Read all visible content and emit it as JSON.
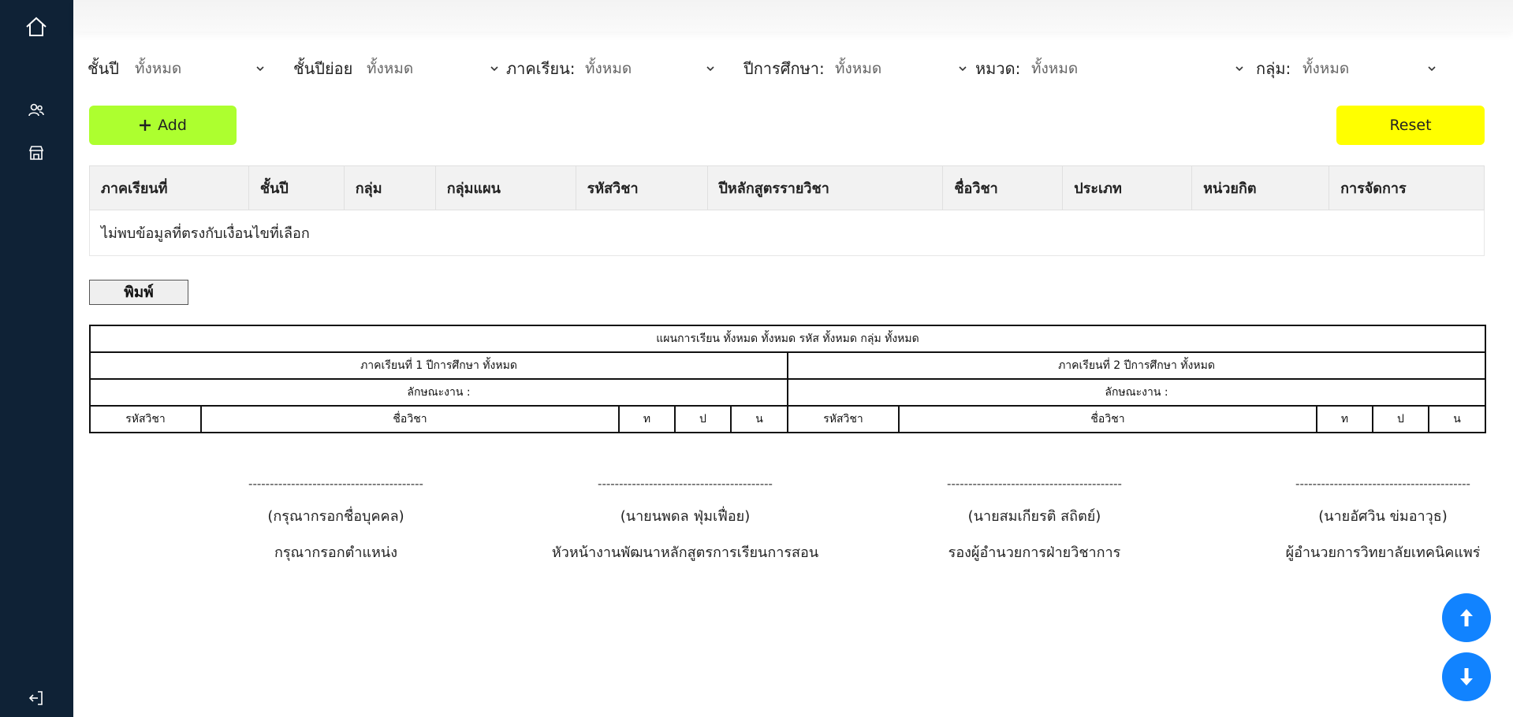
{
  "sidebar": {
    "icons": [
      "home-icon",
      "users-icon",
      "store-icon",
      "logout-icon"
    ]
  },
  "filters": [
    {
      "label": "ชั้นปี",
      "value": "ทั้งหมด"
    },
    {
      "label": "ชั้นปีย่อย",
      "value": "ทั้งหมด"
    },
    {
      "label": "ภาคเรียน:",
      "value": "ทั้งหมด"
    },
    {
      "label": "ปีการศึกษา:",
      "value": "ทั้งหมด"
    },
    {
      "label": "หมวด:",
      "value": "ทั้งหมด"
    },
    {
      "label": "กลุ่ม:",
      "value": "ทั้งหมด"
    }
  ],
  "toolbar": {
    "add_label": "Add",
    "reset_label": "Reset",
    "add_color": "#adff2f",
    "reset_color": "#ffff00"
  },
  "table": {
    "headers": [
      "ภาคเรียนที่",
      "ชั้นปี",
      "กลุ่ม",
      "กลุ่มแผน",
      "รหัสวิชา",
      "ปีหลักสูตรรายวิชา",
      "ชื่อวิชา",
      "ประเภท",
      "หน่วยกิต",
      "การจัดการ"
    ],
    "empty_message": "ไม่พบข้อมูลที่ตรงกับเงื่อนไขที่เลือก"
  },
  "print": {
    "button_label": "พิมพ์",
    "title": "แผนการเรียน ทั้งหมด ทั้งหมด รหัส ทั้งหมด กลุ่ม ทั้งหมด",
    "term1": "ภาคเรียนที่ 1 ปีการศึกษา ทั้งหมด",
    "term2": "ภาคเรียนที่ 2 ปีการศึกษา ทั้งหมด",
    "character_label": "ลักษณะงาน :",
    "col_code": "รหัสวิชา",
    "col_name": "ชื่อวิชา",
    "col_t": "ท",
    "col_p": "ป",
    "col_n": "น"
  },
  "signatures": [
    {
      "dash": "-----------------------------------------",
      "name": "(กรุณากรอกชื่อบุคคล)",
      "position": "กรุณากรอกตำแหน่ง"
    },
    {
      "dash": "-----------------------------------------",
      "name": "(นายนพดล ฟุ่มเฟื่อย)",
      "position": "หัวหน้างานพัฒนาหลักสูตรการเรียนการสอน"
    },
    {
      "dash": "-----------------------------------------",
      "name": "(นายสมเกียรติ สถิตย์)",
      "position": "รองผู้อำนวยการฝ่ายวิชาการ"
    },
    {
      "dash": "-----------------------------------------",
      "name": "(นายอัศวิน ข่มอาวุธ)",
      "position": "ผู้อำนวยการวิทยาลัยเทคนิคแพร่"
    }
  ],
  "fab": {
    "up_icon": "arrow-up-icon",
    "down_icon": "arrow-down-icon",
    "color": "#1183ff"
  }
}
